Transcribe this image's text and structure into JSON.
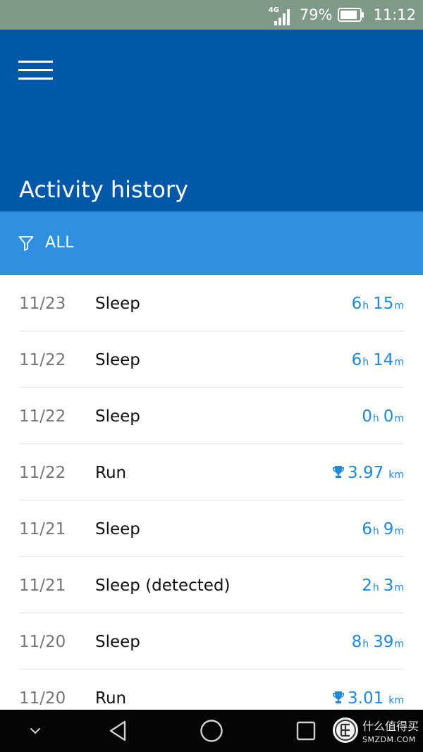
{
  "status_bar": {
    "network": "4G",
    "battery_percent": "79%",
    "time": "11:12"
  },
  "header": {
    "title": "Activity history"
  },
  "filter": {
    "label": "ALL"
  },
  "activities": [
    {
      "date": "11/23",
      "type": "Sleep",
      "hours": "6",
      "hours_unit": "h",
      "minutes": "15",
      "minutes_unit": "m"
    },
    {
      "date": "11/22",
      "type": "Sleep",
      "hours": "6",
      "hours_unit": "h",
      "minutes": "14",
      "minutes_unit": "m"
    },
    {
      "date": "11/22",
      "type": "Sleep",
      "hours": "0",
      "hours_unit": "h",
      "minutes": "0",
      "minutes_unit": "m"
    },
    {
      "date": "11/22",
      "type": "Run",
      "distance": "3.97",
      "distance_unit": "km"
    },
    {
      "date": "11/21",
      "type": "Sleep",
      "hours": "6",
      "hours_unit": "h",
      "minutes": "9",
      "minutes_unit": "m"
    },
    {
      "date": "11/21",
      "type": "Sleep (detected)",
      "hours": "2",
      "hours_unit": "h",
      "minutes": "3",
      "minutes_unit": "m"
    },
    {
      "date": "11/20",
      "type": "Sleep",
      "hours": "8",
      "hours_unit": "h",
      "minutes": "39",
      "minutes_unit": "m"
    },
    {
      "date": "11/20",
      "type": "Run",
      "distance": "3.01",
      "distance_unit": "km"
    }
  ],
  "watermark": {
    "line1": "什么值得买",
    "line2": "SMZDM.COM"
  },
  "icons": {
    "menu": "hamburger-icon",
    "filter": "filter-icon",
    "trophy": "trophy-icon",
    "nav_hide": "chevron-down-icon",
    "nav_back": "back-triangle-icon",
    "nav_home": "home-circle-icon",
    "nav_recent": "recent-square-icon"
  },
  "colors": {
    "header_bg": "#0158a8",
    "filter_bg": "#2f90e0",
    "accent_value": "#1e88d9",
    "status_bar_bg": "#7f9a87",
    "nav_bar_bg": "#050505",
    "divider": "#e4e4e4"
  }
}
